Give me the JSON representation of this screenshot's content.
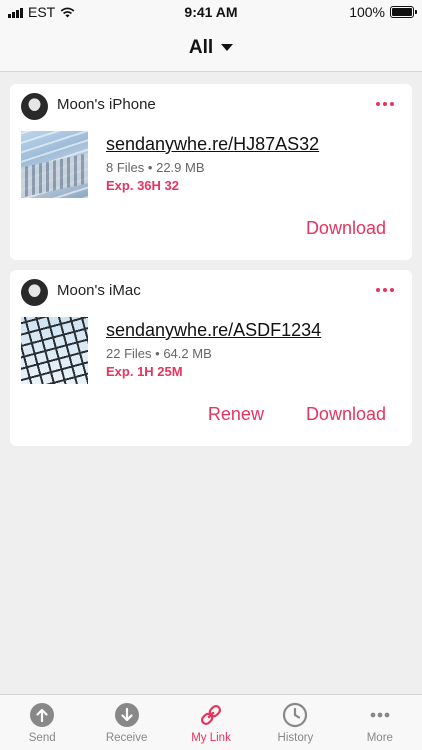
{
  "status": {
    "carrier": "EST",
    "time": "9:41 AM",
    "battery": "100%"
  },
  "nav": {
    "filter_label": "All"
  },
  "colors": {
    "accent": "#e8335d",
    "inactive": "#888888"
  },
  "cards": [
    {
      "device": "Moon's iPhone",
      "link": "sendanywhe.re/HJ87AS32",
      "files": "8 Files",
      "size": "22.9 MB",
      "expiry": "Exp. 36H 32",
      "download_label": "Download"
    },
    {
      "device": "Moon's iMac",
      "link": "sendanywhe.re/ASDF1234",
      "files": "22 Files",
      "size": "64.2 MB",
      "expiry": "Exp. 1H 25M",
      "renew_label": "Renew",
      "download_label": "Download"
    }
  ],
  "tabs": [
    {
      "label": "Send",
      "icon": "arrow-up-circle-icon",
      "active": false
    },
    {
      "label": "Receive",
      "icon": "arrow-down-circle-icon",
      "active": false
    },
    {
      "label": "My Link",
      "icon": "link-icon",
      "active": true
    },
    {
      "label": "History",
      "icon": "clock-icon",
      "active": false
    },
    {
      "label": "More",
      "icon": "ellipsis-icon",
      "active": false
    }
  ]
}
